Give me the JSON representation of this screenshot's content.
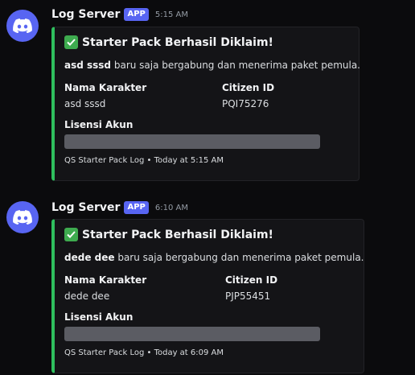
{
  "messages": [
    {
      "username": "Log Server",
      "badge": "APP",
      "time": "5:15 AM",
      "embed": {
        "title": "Starter Pack Berhasil Diklaim!",
        "desc_name": "asd sssd",
        "desc_rest": " baru saja bergabung dan menerima paket pemula.",
        "field1_name": "Nama Karakter",
        "field1_value": "asd sssd",
        "field2_name": "Citizen ID",
        "field2_value": "PQI75276",
        "field3_name": "Lisensi Akun",
        "footer": "QS Starter Pack Log • Today at 5:15 AM"
      }
    },
    {
      "username": "Log Server",
      "badge": "APP",
      "time": "6:10 AM",
      "embed": {
        "title": "Starter Pack Berhasil Diklaim!",
        "desc_name": "dede dee",
        "desc_rest": " baru saja bergabung dan menerima paket pemula.",
        "field1_name": "Nama Karakter",
        "field1_value": "dede dee",
        "field2_name": "Citizen ID",
        "field2_value": "PJP55451",
        "field3_name": "Lisensi Akun",
        "footer": "QS Starter Pack Log • Today at 6:09 AM"
      }
    }
  ],
  "colors": {
    "accent": "#5865f2",
    "embed_border": "#2fbf5e",
    "spoiler": "#5b5c63"
  },
  "icons": {
    "avatar": "discord-icon",
    "title_emoji": "check-mark-icon"
  }
}
